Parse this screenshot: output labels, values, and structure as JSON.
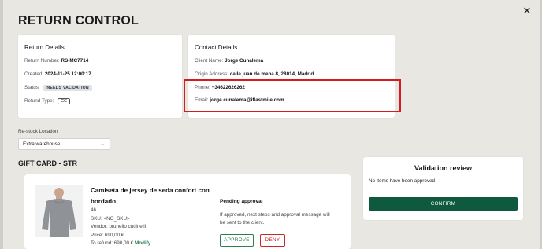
{
  "modal": {
    "title": "RETURN CONTROL",
    "close_icon": "✕"
  },
  "return_details": {
    "heading": "Return Details",
    "return_number_label": "Return Number:",
    "return_number": "RS-MC7714",
    "created_label": "Created:",
    "created": "2024-11-25 12:00:17",
    "status_label": "Status:",
    "status": "NEEDS VALIDATION",
    "refund_type_label": "Refund Type:",
    "refund_type": "GC"
  },
  "contact_details": {
    "heading": "Contact Details",
    "client_name_label": "Client Name:",
    "client_name": "Jorge Cunalema",
    "origin_address_label": "Origin Address:",
    "origin_address": "calle juan de mena 8, 28014, Madrid",
    "phone_label": "Phone:",
    "phone": "+34622626262",
    "email_label": "Email:",
    "email": "jorge.cunalema@iflastmile.com"
  },
  "restock": {
    "label": "Re-stock Location",
    "selected": "Extra warehouse"
  },
  "section": {
    "title": "GIFT CARD - STR"
  },
  "product": {
    "name_line1": "Camiseta de jersey de seda confort con",
    "name_line2": "bordado",
    "size": "46",
    "sku": "SKU: <NO_SKU>",
    "vendor": "Vendor: brunello cucinelli",
    "price": "Price: 690,00 €",
    "refund_label": "To refund:",
    "refund_value": "690,00 €",
    "modify_label": "Modify"
  },
  "approval": {
    "heading": "Pending approval",
    "text_line1": "If approved, next steps and approval message will",
    "text_line2": "be sent to the client.",
    "approve_label": "APPROVE",
    "deny_label": "DENY"
  },
  "validation": {
    "heading": "Validation review",
    "message": "No items have been approved",
    "confirm_label": "CONFIRM"
  },
  "colors": {
    "accent": "#0f5a3f",
    "danger": "#c62828",
    "approve": "#2e7d4f",
    "highlight": "#d51c1c"
  }
}
